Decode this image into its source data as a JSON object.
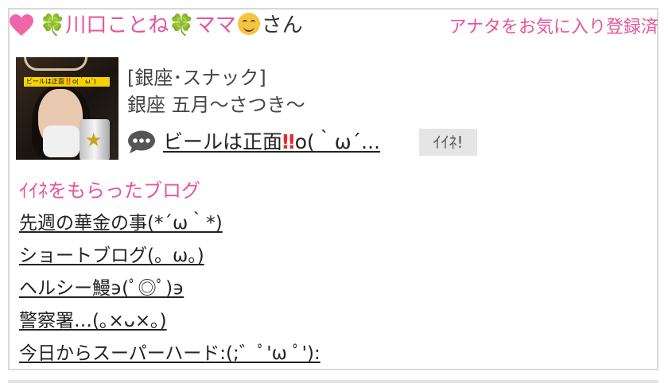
{
  "header": {
    "heart_icon": "heart-icon",
    "clover_icon": "four-leaf-clover",
    "name_part1": "川口ことね",
    "name_part2": "ママ",
    "honorific": "さん",
    "clover_glyph": "🍀",
    "favorite_status": "アナタをお気に入り登録済",
    "accent_color": "#e8549b"
  },
  "shop": {
    "category": "[銀座･スナック]",
    "name": "銀座 五月～さつき～",
    "photo_caption": "ビールは正面‼️o(｀ω´)"
  },
  "latest_post": {
    "title_before": "ビールは正面",
    "title_bang": "‼",
    "title_after": "o(｀ω´...",
    "like_label": "ｲｲﾈ!"
  },
  "liked_blogs": {
    "heading": "ｲｲﾈをもらったブログ",
    "items": [
      "先週の華金の事(*´ω｀*)",
      "ショートブログ(。ω。)",
      "ヘルシー鰻϶(ﾟ◎ﾟ)϶",
      "警察署…(｡×ᴗ×｡)",
      "今日からスーパーハード:(;゛ﾟ'ω ﾟ'):"
    ]
  }
}
